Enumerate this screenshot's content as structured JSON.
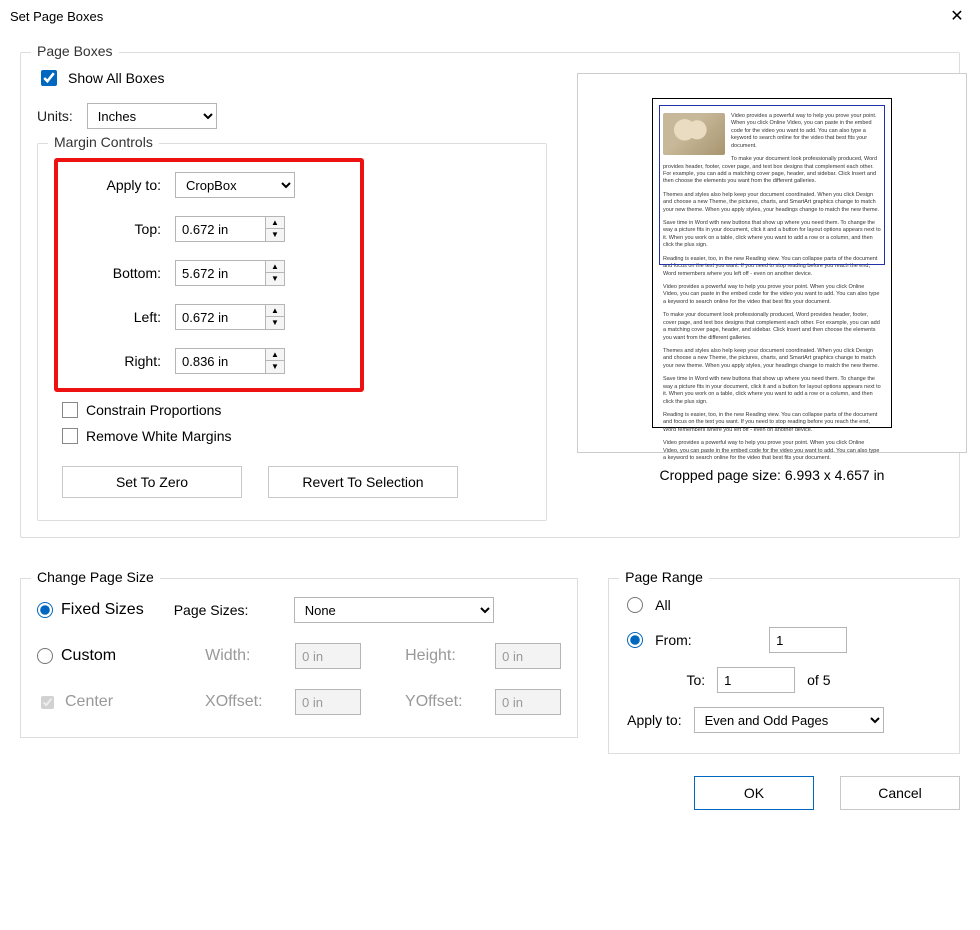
{
  "title": "Set Page Boxes",
  "pageBoxes": {
    "legend": "Page Boxes",
    "showAll": "Show All Boxes",
    "unitsLabel": "Units:",
    "unitsValue": "Inches",
    "margin": {
      "legend": "Margin Controls",
      "applyToLabel": "Apply to:",
      "applyToValue": "CropBox",
      "top": {
        "label": "Top:",
        "value": "0.672 in"
      },
      "bottom": {
        "label": "Bottom:",
        "value": "5.672 in"
      },
      "left": {
        "label": "Left:",
        "value": "0.672 in"
      },
      "right": {
        "label": "Right:",
        "value": "0.836 in"
      },
      "constrain": "Constrain Proportions",
      "removeWhite": "Remove White Margins",
      "setZero": "Set To Zero",
      "revert": "Revert To Selection"
    },
    "croppedSize": "Cropped page size: 6.993 x 4.657 in"
  },
  "changeSize": {
    "legend": "Change Page Size",
    "fixed": "Fixed Sizes",
    "pageSizesLabel": "Page Sizes:",
    "pageSizesValue": "None",
    "custom": "Custom",
    "widthLabel": "Width:",
    "widthValue": "0 in",
    "heightLabel": "Height:",
    "heightValue": "0 in",
    "center": "Center",
    "xoffLabel": "XOffset:",
    "xoffValue": "0 in",
    "yoffLabel": "YOffset:",
    "yoffValue": "0 in"
  },
  "pageRange": {
    "legend": "Page Range",
    "all": "All",
    "fromLabel": "From:",
    "fromValue": "1",
    "toLabel": "To:",
    "toValue": "1",
    "ofText": "of 5",
    "applyToLabel": "Apply to:",
    "applyToValue": "Even and Odd Pages"
  },
  "footer": {
    "ok": "OK",
    "cancel": "Cancel"
  }
}
